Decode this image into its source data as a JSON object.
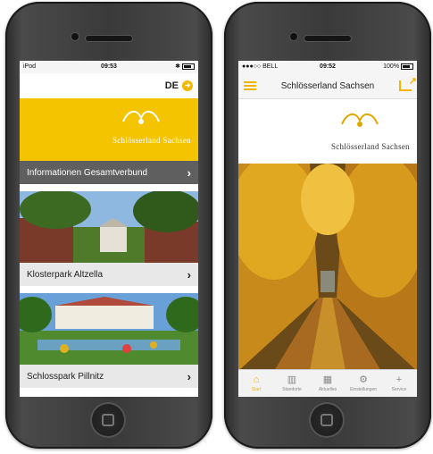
{
  "left_phone": {
    "status": {
      "carrier": "iPod",
      "time": "09:53",
      "bluetooth": "✱"
    },
    "language": {
      "label": "DE"
    },
    "logo": {
      "text": "Schlösserland Sachsen"
    },
    "info_row": {
      "label": "Informationen Gesamtverbund"
    },
    "cards": [
      {
        "label": "Klosterpark Altzella"
      },
      {
        "label": "Schlosspark Pillnitz"
      }
    ]
  },
  "right_phone": {
    "status": {
      "carrier": "●●●○○ BELL",
      "time": "09:52",
      "battery": "100%"
    },
    "navbar": {
      "title": "Schlösserland Sachsen"
    },
    "logo": {
      "text": "Schlösserland Sachsen"
    },
    "tabs": [
      {
        "label": "Start",
        "icon": "home-icon",
        "glyph": "⌂"
      },
      {
        "label": "Standorte",
        "icon": "map-icon",
        "glyph": "▥"
      },
      {
        "label": "Aktuelles",
        "icon": "calendar-icon",
        "glyph": "▦"
      },
      {
        "label": "Einstellungen",
        "icon": "gears-icon",
        "glyph": "⚙"
      },
      {
        "label": "Service",
        "icon": "plus-icon",
        "glyph": "+"
      }
    ]
  },
  "colors": {
    "accent": "#f4c400",
    "tab_active": "#f4b400",
    "menu_bg": "#5f5f5f"
  }
}
